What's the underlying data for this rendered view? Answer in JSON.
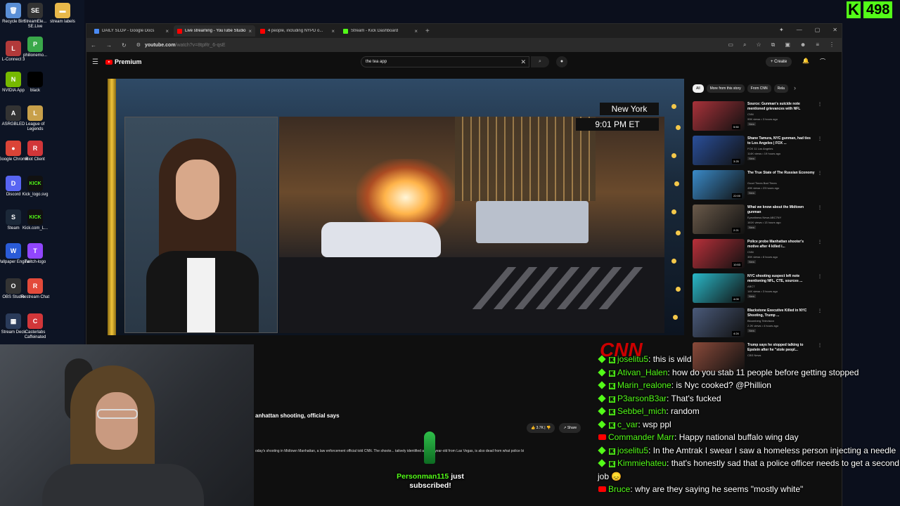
{
  "desktop": {
    "icons": [
      {
        "label": "Recycle Bin",
        "color": "#5a8fd6",
        "glyph": "🗑"
      },
      {
        "label": "StreamEle... SE.Live",
        "color": "#333",
        "glyph": "SE"
      },
      {
        "label": "stream labels",
        "color": "#e8b84a",
        "glyph": "▬"
      },
      {
        "label": "L-Connect 3",
        "color": "#b23a3a",
        "glyph": "L"
      },
      {
        "label": "philionemo...",
        "color": "#3aa84a",
        "glyph": "P"
      },
      {
        "label": "NVIDIA App",
        "color": "#76b900",
        "glyph": "N"
      },
      {
        "label": "black",
        "color": "#000",
        "glyph": ""
      },
      {
        "label": "ASRGBLED",
        "color": "#333",
        "glyph": "A"
      },
      {
        "label": "League of Legends",
        "color": "#c8a04a",
        "glyph": "L"
      },
      {
        "label": "Google Chrome",
        "color": "#db4437",
        "glyph": "●"
      },
      {
        "label": "Riot Client",
        "color": "#d13639",
        "glyph": "R"
      },
      {
        "label": "Discord",
        "color": "#5865f2",
        "glyph": "D"
      },
      {
        "label": "Kick_logo.svg",
        "color": "#111",
        "glyph": "KICK"
      },
      {
        "label": "Steam",
        "color": "#1b2838",
        "glyph": "S"
      },
      {
        "label": "Kick.com_L...",
        "color": "#111",
        "glyph": "KICK"
      },
      {
        "label": "Wallpaper Engine",
        "color": "#2a5bd7",
        "glyph": "W"
      },
      {
        "label": "Twitch-logo",
        "color": "#9146ff",
        "glyph": "T"
      },
      {
        "label": "OBS Studio",
        "color": "#333",
        "glyph": "O"
      },
      {
        "label": "Restream Chat",
        "color": "#e34a3a",
        "glyph": "R"
      },
      {
        "label": "Stream Deck",
        "color": "#2a3b5a",
        "glyph": "▦"
      },
      {
        "label": "Casterlabs Caffeinated",
        "color": "#d13639",
        "glyph": "C"
      }
    ]
  },
  "kick_counter": {
    "logo": "K",
    "count": "498"
  },
  "browser": {
    "tabs": [
      {
        "label": "DAILY SLOP - Google Docs",
        "fav": "#4a8af4",
        "active": false
      },
      {
        "label": "Live streaming - YouTube Studio",
        "fav": "#ff0000",
        "active": true
      },
      {
        "label": "4 people, including NYPD o...",
        "fav": "#ff0000",
        "active": false
      },
      {
        "label": "Stream - Kick Dashboard",
        "fav": "#53fc18",
        "active": false
      }
    ],
    "url_host": "youtube.com",
    "url_path": "/watch?v=8tpRr_6-qsE"
  },
  "youtube": {
    "logo_text": "Premium",
    "search_value": "the tea app",
    "create_label": "Create",
    "video_title": "anhattan shooting, official says",
    "like_count": "3.7K",
    "share_label": "Share",
    "description": "oday's shooting in Midtown Manhattan, a law enforcement official told CNN. The shoote... tatively identified as a 27-year-old from Las Vegas, is also dead from what police bi",
    "overlay_location": "New York",
    "overlay_time": "9:01 PM ET",
    "network": "CNN",
    "chips": [
      {
        "label": "All",
        "active": true
      },
      {
        "label": "More from this story",
        "active": false
      },
      {
        "label": "From CNN",
        "active": false
      },
      {
        "label": "Rela",
        "active": false
      }
    ],
    "recommendations": [
      {
        "title": "Source: Gunman's suicide note mentioned grievances with NFL",
        "channel": "CNN",
        "views": "99K views • 3 hours ago",
        "badge": "New",
        "duration": "5:50",
        "color": "#a8323a"
      },
      {
        "title": "Shane Tamura, NYC gunman, had ties to Los Angeles | FOX ...",
        "channel": "FOX 11 Los Angeles",
        "views": "114K views • 19 hours ago",
        "badge": "New",
        "duration": "3:25",
        "color": "#2a4f9a"
      },
      {
        "title": "The True State of The Russian Economy",
        "channel": "Good Times Bad Times",
        "views": "49K views • 23 hours ago",
        "badge": "New",
        "duration": "22:00",
        "color": "#3a8ac8"
      },
      {
        "title": "What we know about the Midtown gunman",
        "channel": "Eyewitness News ABC7NY",
        "views": "161K views • 13 hours ago",
        "badge": "New",
        "duration": "2:21",
        "color": "#6a5a4a"
      },
      {
        "title": "Police probe Manhattan shooter's motive after 4 killed i...",
        "channel": "CNN",
        "views": "35K views • 8 hours ago",
        "badge": "New",
        "duration": "10:53",
        "color": "#b8303a"
      },
      {
        "title": "NYC shooting suspect left note mentioning NFL, CTE, sources ...",
        "channel": "ABC7",
        "views": "14K views • 3 hours ago",
        "badge": "New",
        "duration": "4:09",
        "color": "#2ab8c8"
      },
      {
        "title": "Blackstone Executive Killed in NYC Shooting, Trump ...",
        "channel": "Bloomberg Television",
        "views": "2.2K views • 4 hours ago",
        "badge": "New",
        "duration": "4:24",
        "color": "#4a5a7a"
      },
      {
        "title": "Trump says he stopped talking to Epstein after he \"stole peopl...",
        "channel": "CBS News",
        "views": "",
        "badge": "",
        "duration": "",
        "color": "#8a4a3a"
      }
    ]
  },
  "chat": {
    "messages": [
      {
        "platform": "kick",
        "user": "joselitu5",
        "text": "this is wild"
      },
      {
        "platform": "kick",
        "user": "Ativan_Halen",
        "text": "how do you stab 11 people before getting stopped"
      },
      {
        "platform": "kick",
        "user": "Marin_realone",
        "text": "is Nyc cooked? @Phillion"
      },
      {
        "platform": "kick",
        "user": "P3arsonB3ar",
        "text": "That's fucked"
      },
      {
        "platform": "kick",
        "user": "Sebbel_mich",
        "text": "random"
      },
      {
        "platform": "kick",
        "user": "c_var",
        "text": "wsp ppl"
      },
      {
        "platform": "youtube",
        "user": "Commander Marr",
        "text": "Happy national buffalo wing day"
      },
      {
        "platform": "kick",
        "user": "joselitu5",
        "text": "In the Amtrak I swear I saw a homeless person injecting a needle"
      },
      {
        "platform": "kick",
        "user": "Kimmiehateu",
        "text": "that's honestly sad that a police officer needs to get a second job 😞"
      },
      {
        "platform": "youtube",
        "user": "Bruce",
        "text": "why are they saying he seems \"mostly white\""
      }
    ]
  },
  "alert": {
    "name": "Personman115",
    "text": "just subscribed!"
  }
}
